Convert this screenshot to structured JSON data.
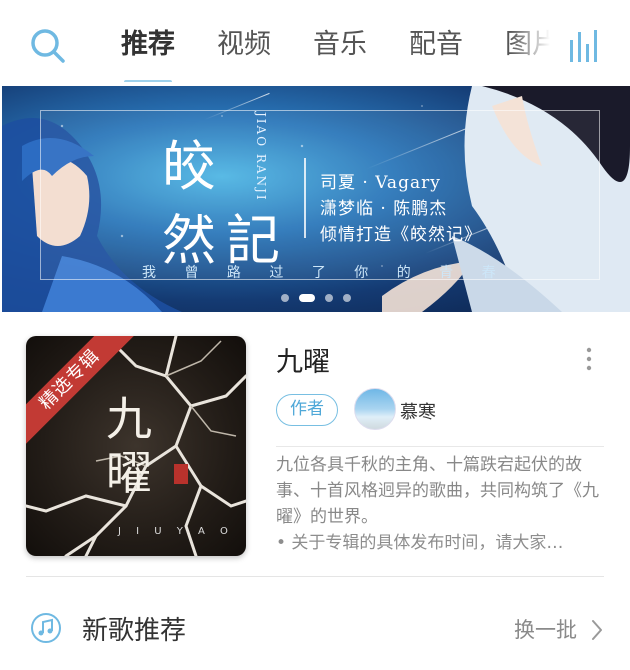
{
  "nav": {
    "tabs": [
      {
        "label": "推荐",
        "active": true
      },
      {
        "label": "视频",
        "active": false
      },
      {
        "label": "音乐",
        "active": false
      },
      {
        "label": "配音",
        "active": false
      },
      {
        "label": "图片",
        "active": false
      }
    ],
    "icons": {
      "search": "search-icon",
      "more": "equalizer-bars-icon"
    },
    "accent": "#6fb9e2"
  },
  "banner": {
    "title_line1": "皎",
    "title_line2": "然記",
    "title_romanized": "JIAO RANJI",
    "credits_line1": "司夏 · Vagary",
    "credits_line2": "潇梦临 · 陈鹏杰",
    "credits_line3": "倾情打造《皎然记》",
    "tagline": "我 曾 路 过 了 你 的 青 春",
    "page_count": 4,
    "active_page": 2
  },
  "album": {
    "badge": "精选专辑",
    "cover_title": "九曜",
    "cover_subtitle": "J I U  Y A O",
    "title": "九曜",
    "role": "作者",
    "artist": "慕寒",
    "description": "九位各具千秋的主角、十篇跌宕起伏的故事、十首风格迥异的歌曲，共同构筑了《九曜》的世界。",
    "note": "• 关于专辑的具体发布时间，请大家…"
  },
  "section": {
    "title": "新歌推荐",
    "action": "换一批",
    "icon": "music-note-icon"
  }
}
